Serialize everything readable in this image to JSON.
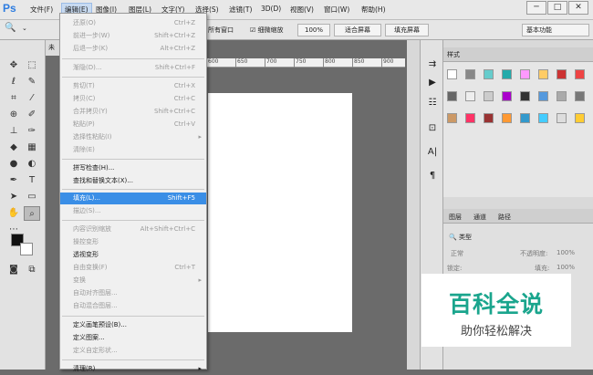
{
  "app": {
    "logo": "Ps"
  },
  "menubar": [
    "文件(F)",
    "编辑(E)",
    "图像(I)",
    "图层(L)",
    "文字(Y)",
    "选择(S)",
    "滤镜(T)",
    "3D(D)",
    "视图(V)",
    "窗口(W)",
    "帮助(H)"
  ],
  "window_controls": [
    "─",
    "□",
    "✕"
  ],
  "options": {
    "check1": "所有窗口",
    "check2": "细微缩放",
    "zoom": "100%",
    "fit": "适合屏幕",
    "fill": "填充屏幕",
    "workspace": "基本功能"
  },
  "doc_tab": "未",
  "ruler": [
    "600",
    "650",
    "700",
    "750",
    "800",
    "850",
    "900"
  ],
  "panel_tabs": {
    "styles": "样式",
    "layers": "图层",
    "channels": "通道",
    "paths": "路径"
  },
  "layers": {
    "kind": "类型",
    "mode": "正常",
    "opacity_label": "不透明度:",
    "opacity": "100%",
    "lock": "锁定:",
    "fill_label": "填充:",
    "fill": "100%"
  },
  "edit_menu": [
    {
      "label": "还原(O)",
      "shortcut": "Ctrl+Z",
      "disabled": true
    },
    {
      "label": "前进一步(W)",
      "shortcut": "Shift+Ctrl+Z",
      "disabled": true
    },
    {
      "label": "后退一步(K)",
      "shortcut": "Alt+Ctrl+Z",
      "disabled": true
    },
    {
      "label": "渐隐(D)...",
      "shortcut": "Shift+Ctrl+F",
      "disabled": true
    },
    {
      "label": "剪切(T)",
      "shortcut": "Ctrl+X",
      "disabled": true
    },
    {
      "label": "拷贝(C)",
      "shortcut": "Ctrl+C",
      "disabled": true
    },
    {
      "label": "合并拷贝(Y)",
      "shortcut": "Shift+Ctrl+C",
      "disabled": true
    },
    {
      "label": "粘贴(P)",
      "shortcut": "Ctrl+V",
      "disabled": true
    },
    {
      "label": "选择性粘贴(I)",
      "shortcut": "",
      "disabled": true,
      "arrow": true
    },
    {
      "label": "清除(E)",
      "shortcut": "",
      "disabled": true
    },
    {
      "label": "拼写检查(H)...",
      "shortcut": "",
      "disabled": false
    },
    {
      "label": "查找和替换文本(X)...",
      "shortcut": "",
      "disabled": false
    },
    {
      "label": "填充(L)...",
      "shortcut": "Shift+F5",
      "disabled": false,
      "highlight": true
    },
    {
      "label": "描边(S)...",
      "shortcut": "",
      "disabled": true
    },
    {
      "label": "内容识别缩放",
      "shortcut": "Alt+Shift+Ctrl+C",
      "disabled": true
    },
    {
      "label": "操控变形",
      "shortcut": "",
      "disabled": true
    },
    {
      "label": "透视变形",
      "shortcut": "",
      "disabled": false
    },
    {
      "label": "自由变换(F)",
      "shortcut": "Ctrl+T",
      "disabled": true
    },
    {
      "label": "变换",
      "shortcut": "",
      "disabled": true,
      "arrow": true
    },
    {
      "label": "自动对齐图层...",
      "shortcut": "",
      "disabled": true
    },
    {
      "label": "自动混合图层...",
      "shortcut": "",
      "disabled": true
    },
    {
      "label": "定义画笔预设(B)...",
      "shortcut": "",
      "disabled": false
    },
    {
      "label": "定义图案...",
      "shortcut": "",
      "disabled": false
    },
    {
      "label": "定义自定形状...",
      "shortcut": "",
      "disabled": true
    },
    {
      "label": "清理(R)",
      "shortcut": "",
      "disabled": false,
      "arrow": true
    }
  ],
  "watermark": {
    "line1": "百科全说",
    "line2": "助你轻松解决"
  },
  "colors": {
    "accent": "#3a8ee6",
    "watermark": "#1aa58d"
  }
}
